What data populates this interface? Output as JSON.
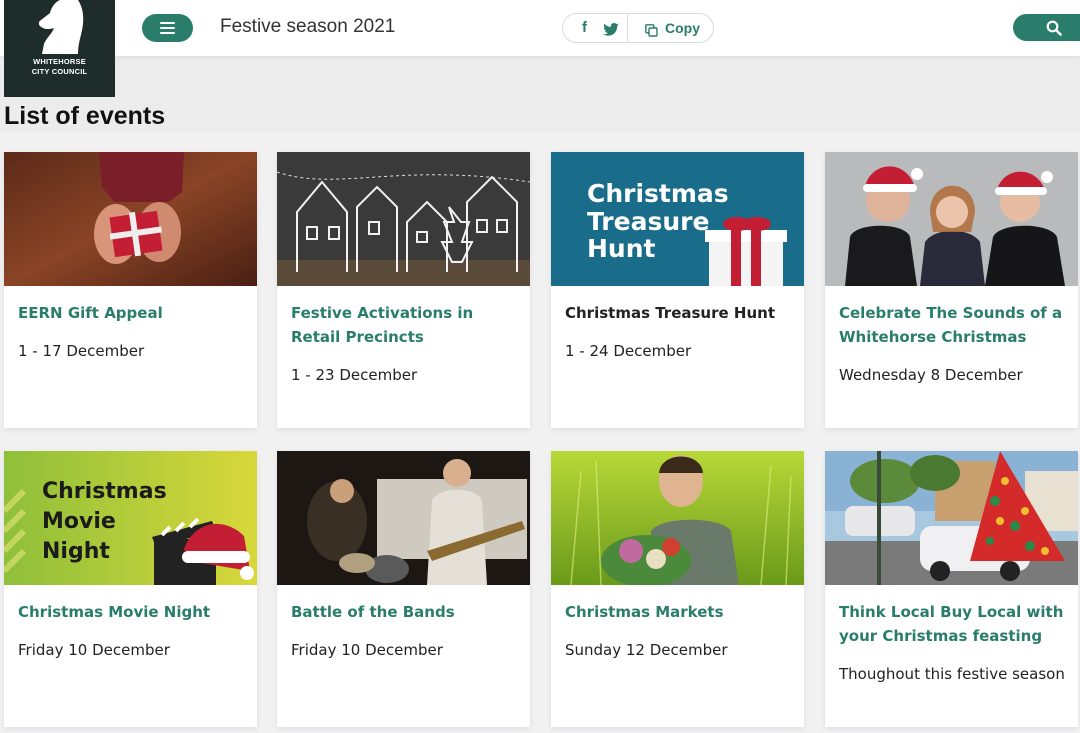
{
  "header": {
    "logo_line1": "WHITEHORSE",
    "logo_line2": "CITY COUNCIL",
    "title": "Festive season 2021",
    "share": {
      "facebook_glyph": "f",
      "copy_label": "Copy"
    },
    "icons": [
      "menu-icon",
      "facebook-icon",
      "twitter-icon",
      "copy-icon",
      "search-icon"
    ]
  },
  "heading": "List of events",
  "colors": {
    "accent": "#2a7d6b",
    "logo_bg": "#1f2d2a",
    "page_bg": "#f1f1f2"
  },
  "events": [
    {
      "title": "EERN Gift Appeal",
      "date": "1 - 17 December"
    },
    {
      "title": "Festive Activations in Retail Precincts",
      "date": "1 - 23 December"
    },
    {
      "title": "Christmas Treasure Hunt",
      "date": "1 - 24 December",
      "image_text_1": "Christmas",
      "image_text_2": "Treasure",
      "image_text_3": "Hunt"
    },
    {
      "title": "Celebrate The Sounds of a Whitehorse Christmas",
      "date": "Wednesday 8 December"
    },
    {
      "title": "Christmas Movie Night",
      "date": "Friday 10 December",
      "image_text_1": "Christmas",
      "image_text_2": "Movie",
      "image_text_3": "Night"
    },
    {
      "title": "Battle of the Bands",
      "date": "Friday 10 December"
    },
    {
      "title": "Christmas Markets",
      "date": "Sunday 12 December"
    },
    {
      "title": "Think Local Buy Local with your Christmas feasting",
      "date": "Thoughout this festive season"
    }
  ]
}
